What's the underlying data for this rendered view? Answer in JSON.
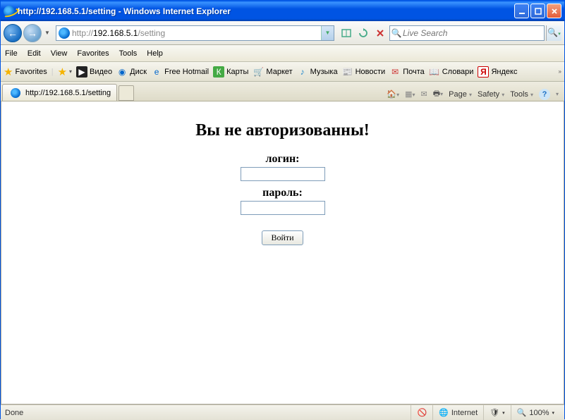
{
  "window": {
    "title": "http://192.168.5.1/setting - Windows Internet Explorer"
  },
  "nav": {
    "url_prefix": "http://",
    "url_host": "192.168.5.1",
    "url_path": "/setting",
    "search_placeholder": "Live Search"
  },
  "menu": {
    "file": "File",
    "edit": "Edit",
    "view": "View",
    "favorites": "Favorites",
    "tools": "Tools",
    "help": "Help"
  },
  "favbar": {
    "favorites": "Favorites",
    "items": [
      "Видео",
      "Диск",
      "Free Hotmail",
      "Карты",
      "Маркет",
      "Музыка",
      "Новости",
      "Почта",
      "Словари",
      "Яндекс"
    ]
  },
  "tab": {
    "title": "http://192.168.5.1/setting"
  },
  "cmdbar": {
    "page": "Page",
    "safety": "Safety",
    "tools": "Tools"
  },
  "page": {
    "heading": "Вы не авторизованны!",
    "login_label": "логин:",
    "password_label": "пароль:",
    "submit": "Войти"
  },
  "status": {
    "done": "Done",
    "zone": "Internet",
    "zoom": "100%"
  }
}
